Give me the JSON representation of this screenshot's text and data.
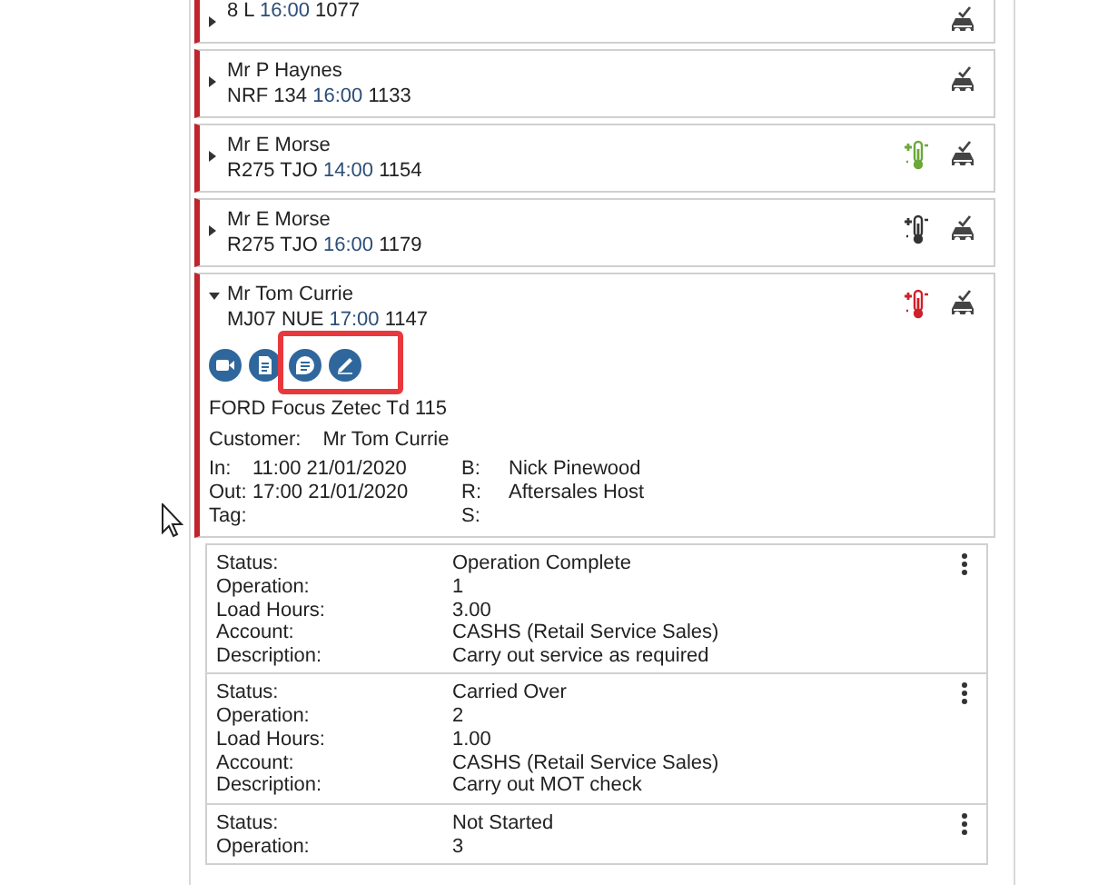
{
  "bookings": [
    {
      "reg": "8 L",
      "time": "16:00",
      "number": "1077",
      "expanded": false
    },
    {
      "name": "Mr P Haynes",
      "reg": "NRF 134",
      "time": "16:00",
      "number": "1133",
      "expanded": false
    },
    {
      "name": "Mr E Morse",
      "reg": "R275 TJO",
      "time": "14:00",
      "number": "1154",
      "expanded": false,
      "thermometer": {
        "color": "#6aa83a"
      }
    },
    {
      "name": "Mr E Morse",
      "reg": "R275 TJO",
      "time": "16:00",
      "number": "1179",
      "expanded": false,
      "thermometer": {
        "color": "#333333"
      }
    },
    {
      "name": "Mr Tom Currie",
      "reg": "MJ07 NUE",
      "time": "17:00",
      "number": "1147",
      "expanded": true,
      "thermometer": {
        "color": "#d0202a"
      },
      "actions": [
        {
          "kind": "video",
          "highlighted": false
        },
        {
          "kind": "document",
          "highlighted": false
        },
        {
          "kind": "notes",
          "highlighted": true
        },
        {
          "kind": "edit",
          "highlighted": true
        }
      ],
      "vehicle": "FORD Focus Zetec Td 115",
      "customer": {
        "label": "Customer:",
        "value": "Mr Tom Currie"
      },
      "details": [
        {
          "label": "In:",
          "value": "11:00 21/01/2020",
          "label2": "B:",
          "value2": "Nick Pinewood"
        },
        {
          "label": "Out:",
          "value": "17:00 21/01/2020",
          "label2": "R:",
          "value2": "Aftersales Host"
        },
        {
          "label": "Tag:",
          "label2": "S:"
        }
      ]
    }
  ],
  "operations": [
    {
      "fields": [
        {
          "label": "Status:",
          "value": "Operation Complete"
        },
        {
          "label": "Operation:",
          "value": "1"
        },
        {
          "label": "Load Hours:",
          "value": "3.00"
        },
        {
          "label": "Account:",
          "value": "CASHS (Retail Service Sales)"
        },
        {
          "label": "Description:",
          "value": "Carry out service as required"
        }
      ]
    },
    {
      "fields": [
        {
          "label": "Status:",
          "value": "Carried Over"
        },
        {
          "label": "Operation:",
          "value": "2"
        },
        {
          "label": "Load Hours:",
          "value": "1.00"
        },
        {
          "label": "Account:",
          "value": "CASHS (Retail Service Sales)"
        },
        {
          "label": "Description:",
          "value": "Carry out MOT check"
        }
      ]
    },
    {
      "fields": [
        {
          "label": "Status:",
          "value": "Not Started"
        },
        {
          "label": "Operation:",
          "value": "3"
        }
      ]
    }
  ]
}
